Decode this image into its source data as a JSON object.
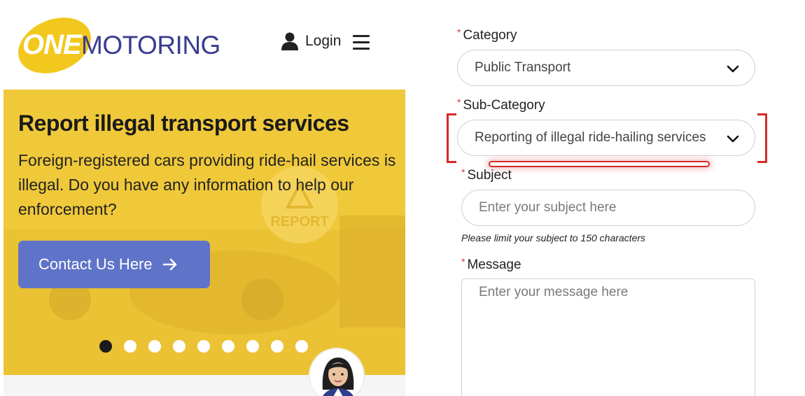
{
  "header": {
    "logo": {
      "part1": "ONE",
      "part2": "MOTORING"
    },
    "login_label": "Login"
  },
  "banner": {
    "title": "Report illegal transport services",
    "body": "Foreign-registered cars providing ride-hail services is illegal. Do you have any information to help our enforcement?",
    "button_label": "Contact Us Here",
    "background_sign_text": "REPORT",
    "carousel_slides": 9,
    "carousel_active_index": 0
  },
  "form": {
    "required_marker": "*",
    "category": {
      "label": "Category",
      "value": "Public Transport"
    },
    "sub_category": {
      "label": "Sub-Category",
      "value": "Reporting of illegal ride-hailing services"
    },
    "subject": {
      "label": "Subject",
      "placeholder": "Enter your subject here",
      "hint": "Please limit your subject to 150 characters"
    },
    "message": {
      "label": "Message",
      "placeholder": "Enter your message here"
    }
  },
  "colors": {
    "brand_yellow": "#f2c81e",
    "brand_navy": "#3a3d8f",
    "button_blue": "#5f73c8",
    "required_red": "#d23a3a",
    "highlight_red": "#d42a2a"
  }
}
